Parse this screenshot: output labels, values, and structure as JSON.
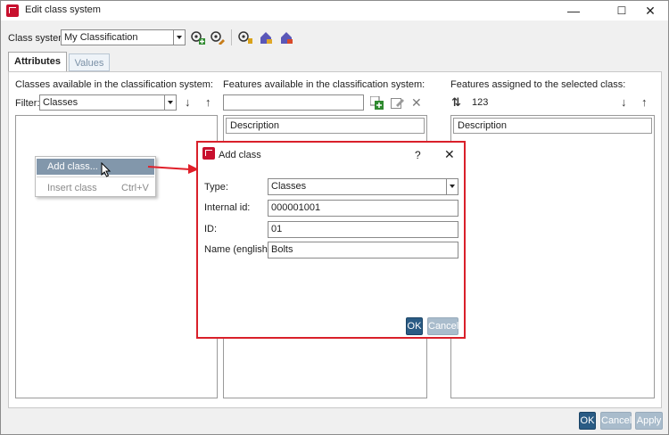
{
  "window": {
    "title": "Edit class system",
    "controls": {
      "minimize": "—",
      "maximize": "☐",
      "close": "✕"
    }
  },
  "toolbar": {
    "class_system_label": "Class system:",
    "class_system_value": "My Classification"
  },
  "tabs": [
    {
      "label": "Attributes",
      "active": true
    },
    {
      "label": "Values",
      "active": false
    }
  ],
  "left_panel": {
    "title": "Classes available in the classification system:",
    "filter_label": "Filter:",
    "filter_value": "Classes",
    "down": "↓",
    "up": "↑"
  },
  "context_menu": {
    "items": [
      {
        "label": "Add class...",
        "shortcut": "",
        "highlighted": true
      },
      {
        "label": "Insert class",
        "shortcut": "Ctrl+V",
        "highlighted": false
      }
    ]
  },
  "middle_panel": {
    "title": "Features available in the classification system:",
    "search_value": "",
    "column_header": "Description"
  },
  "right_panel": {
    "title": "Features assigned to the selected class:",
    "sort_alpha": "⇅",
    "sort_num": "123",
    "down": "↓",
    "up": "↑",
    "column_header": "Description"
  },
  "dialog": {
    "title": "Add class",
    "help": "?",
    "close": "✕",
    "fields": {
      "type_label": "Type:",
      "type_value": "Classes",
      "internal_id_label": "Internal id:",
      "internal_id_value": "000001001",
      "id_label": "ID:",
      "id_value": "01",
      "name_label": "Name (english):",
      "name_value": "Bolts"
    },
    "ok": "OK",
    "cancel": "Cancel"
  },
  "footer": {
    "ok": "OK",
    "cancel": "Cancel",
    "apply": "Apply"
  },
  "colors": {
    "highlight_red": "#d9202a",
    "primary_button": "#2a5b84",
    "disabled_button": "#a9bccc",
    "menu_highlight": "#8297ab"
  }
}
